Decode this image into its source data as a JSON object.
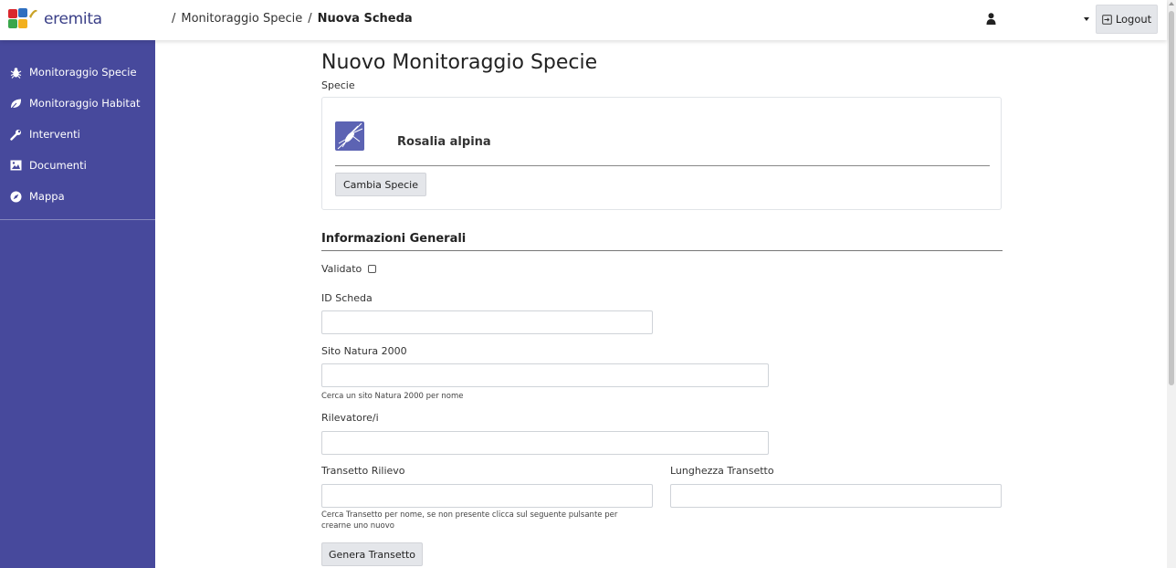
{
  "app": {
    "logo_text": "eremita"
  },
  "breadcrumb": {
    "sep1": "/",
    "item1": "Monitoraggio Specie",
    "sep2": "/",
    "current": "Nuova Scheda"
  },
  "header": {
    "logout_label": "Logout"
  },
  "sidebar": {
    "items": [
      {
        "label": "Monitoraggio Specie",
        "icon": "bug-icon"
      },
      {
        "label": "Monitoraggio Habitat",
        "icon": "leaf-icon"
      },
      {
        "label": "Interventi",
        "icon": "wrench-icon"
      },
      {
        "label": "Documenti",
        "icon": "image-icon"
      },
      {
        "label": "Mappa",
        "icon": "compass-icon"
      }
    ]
  },
  "form": {
    "title": "Nuovo Monitoraggio Specie",
    "species_label": "Specie",
    "species_name": "Rosalia alpina",
    "change_species_button": "Cambia Specie",
    "section_title": "Informazioni Generali",
    "validated_label": "Validato",
    "validated_checked": false,
    "id_label": "ID Scheda",
    "id_value": "",
    "site_label": "Sito Natura 2000",
    "site_value": "",
    "site_help": "Cerca un sito Natura 2000 per nome",
    "surveyor_label": "Rilevatore/i",
    "surveyor_value": "",
    "transect_label": "Transetto Rilievo",
    "transect_value": "",
    "transect_help_1": "Cerca Transetto per nome, se non presente clicca sul seguente pulsante per",
    "transect_help_2": "crearne uno nuovo",
    "length_label": "Lunghezza Transetto",
    "length_value": "",
    "generate_button": "Genera Transetto"
  },
  "colors": {
    "sidebar_bg": "#47499c",
    "button_bg": "#e4e6ea"
  }
}
